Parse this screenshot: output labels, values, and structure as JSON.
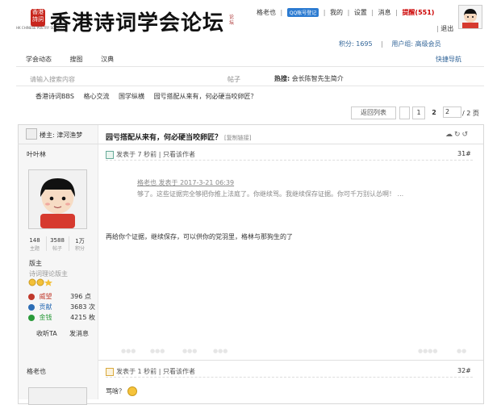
{
  "logo": {
    "seal": "香港詩詞",
    "subtitle": "HK CHINESE POETRY SOCIETY",
    "title": "香港诗词学会论坛",
    "side": "论坛"
  },
  "topbar": {
    "username": "格老也",
    "qq_button": "QQ账号登记",
    "items": [
      "我的",
      "设置",
      "消息"
    ],
    "reminder": "提醒(551)",
    "logout": "退出",
    "points_label": "积分: 1695",
    "usergroup_label": "用户组: 高级会员"
  },
  "nav": {
    "items": [
      "学会动态",
      "搜图",
      "汉典"
    ],
    "quick": "快捷导航"
  },
  "search": {
    "placeholder": "请输入搜索内容",
    "category": "帖子",
    "hot_label": "热搜:",
    "hot_item": "会长陈智先生简介"
  },
  "breadcrumb": [
    "香港诗词BBS",
    "格心交流",
    "国学纵横",
    "园亏搭配从来有，何必硬当咬卵匠？"
  ],
  "pager": {
    "return_label": "返回列表",
    "page1": "1",
    "page2": "2",
    "input_value": "2",
    "total": "/ 2 页"
  },
  "post1": {
    "op_label": "楼主: 津河渔梦",
    "author": "叶叶林",
    "stats": [
      {
        "num": "148",
        "label": "主题"
      },
      {
        "num": "3588",
        "label": "帖子"
      },
      {
        "num": "1万",
        "label": "积分"
      }
    ],
    "rank": "版主",
    "rank_title": "诗词理论版主",
    "fields": [
      {
        "label": "威望",
        "value": "396 点",
        "color": "#c0392b"
      },
      {
        "label": "贡献",
        "value": "3683 次",
        "color": "#2d6db5"
      },
      {
        "label": "金钱",
        "value": "4215 枚",
        "color": "#2a9a3a"
      }
    ],
    "follow": "收听TA",
    "message": "发消息",
    "title": "园亏搭配从来有，何必硬当咬卵匠？",
    "copy_link": "[复制链接]",
    "meta": "发表于 7 秒前 | 只看该作者",
    "floor": "31#",
    "quote_head": "格老也 发表于 2017-3-21 06:39",
    "quote_body": "够了。这些证据完全够把你推上法庭了。你继续骂。我继续保存证据。你可千万别认怂啊！ ...",
    "body": "再给你个证据，继续保存，可以供你的党羽里，格林与那狗生的了"
  },
  "post2": {
    "author": "格老也",
    "meta": "发表于 1 秒前 | 只看该作者",
    "floor": "32#",
    "body": "骂啥？"
  },
  "colors": {
    "accent": "#336699",
    "reminder": "#cc0000",
    "qq_blue": "#2c7bd1"
  }
}
